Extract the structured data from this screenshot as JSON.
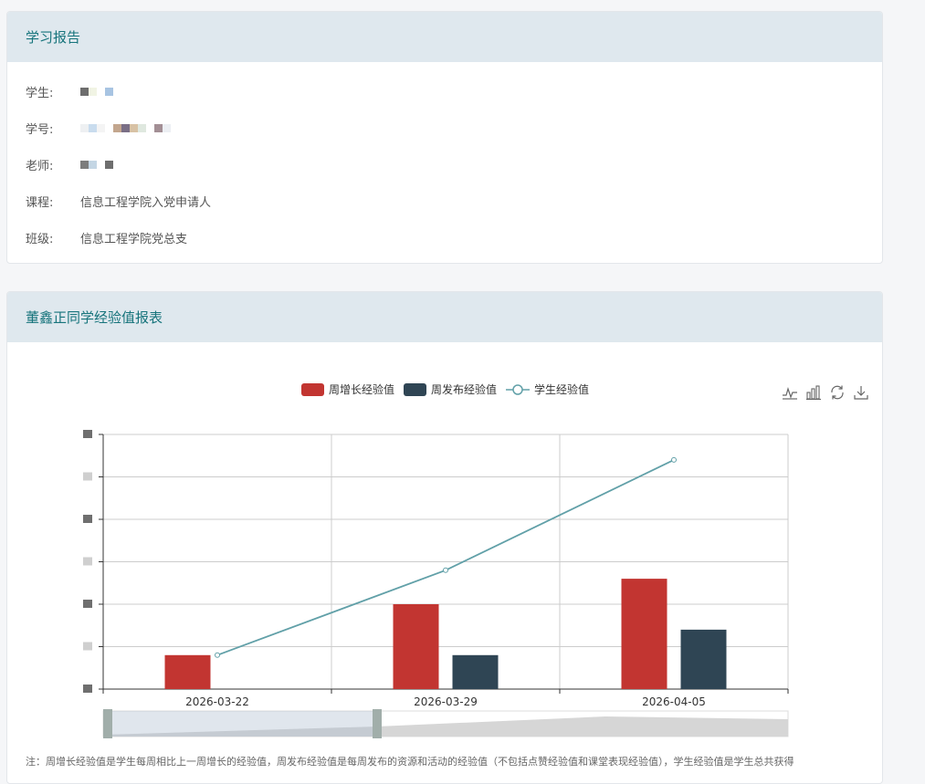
{
  "report": {
    "title": "学习报告",
    "fields": [
      {
        "label": "学生:",
        "value": "",
        "masked": true
      },
      {
        "label": "学号:",
        "value": "",
        "masked": true
      },
      {
        "label": "老师:",
        "value": "",
        "masked": true
      },
      {
        "label": "课程:",
        "value": "信息工程学院入党申请人",
        "masked": false
      },
      {
        "label": "班级:",
        "value": "信息工程学院党总支",
        "masked": false
      }
    ]
  },
  "exp_report": {
    "title": "董鑫正同学经验值报表",
    "note": "注：周增长经验值是学生每周相比上一周增长的经验值，周发布经验值是每周发布的资源和活动的经验值（不包括点赞经验值和课堂表现经验值），学生经验值是学生总共获得"
  },
  "toolbox": [
    "line-chart-icon",
    "bar-chart-icon",
    "restore-icon",
    "download-icon"
  ],
  "chart_data": {
    "type": "bar",
    "categories": [
      "2026-03-22",
      "2026-03-29",
      "2026-04-05"
    ],
    "series": [
      {
        "name": "周增长经验值",
        "type": "bar",
        "color": "#c23531",
        "values": [
          8,
          20,
          26
        ]
      },
      {
        "name": "周发布经验值",
        "type": "bar",
        "color": "#2f4554",
        "values": [
          0,
          8,
          14
        ]
      },
      {
        "name": "学生经验值",
        "type": "line",
        "color": "#61a0a8",
        "values": [
          8,
          28,
          54
        ]
      }
    ],
    "ylim": [
      0,
      60
    ],
    "y_ticks": [
      0,
      10,
      20,
      30,
      40,
      50,
      60
    ],
    "legend_position": "top-center",
    "grid": true,
    "datazoom": {
      "start": 0,
      "end": 40
    }
  }
}
